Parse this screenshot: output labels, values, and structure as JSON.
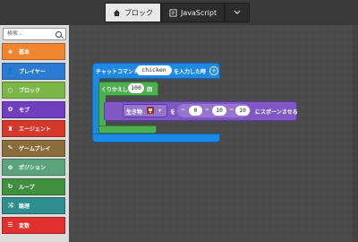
{
  "tabs": {
    "blocks_label": "ブロック",
    "javascript_label": "JavaScript"
  },
  "palette": {
    "search_placeholder": "検索...",
    "categories": [
      {
        "label": "基本",
        "color": "#f0852f",
        "icon": "star-icon"
      },
      {
        "label": "プレイヤー",
        "color": "#2b7bd1",
        "icon": "person-icon"
      },
      {
        "label": "ブロック",
        "color": "#7ab648",
        "icon": "cube-icon"
      },
      {
        "label": "モブ",
        "color": "#6f3fbf",
        "icon": "paw-icon"
      },
      {
        "label": "エージェント",
        "color": "#d6372b",
        "icon": "agent-icon"
      },
      {
        "label": "ゲームプレイ",
        "color": "#8a6d3b",
        "icon": "wrench-icon"
      },
      {
        "label": "ポジション",
        "color": "#5aa37c",
        "icon": "target-icon"
      },
      {
        "label": "ループ",
        "color": "#3f8f3f",
        "icon": "loop-icon"
      },
      {
        "label": "論理",
        "color": "#2f8f8f",
        "icon": "shuffle-icon"
      },
      {
        "label": "変数",
        "color": "#e0302f",
        "icon": "list-icon"
      }
    ]
  },
  "workspace": {
    "event_block": {
      "prefix": "チャットコマンド",
      "command_value": "chicken",
      "suffix": "を入力した時",
      "plus_symbol": "+"
    },
    "repeat_block": {
      "label": "くりかえし",
      "count": "100",
      "times_label": "回"
    },
    "spawn_block": {
      "mob_label": "生き物",
      "arrow": "▾",
      "at_label": "を",
      "coords_prefix": "~",
      "x": "0",
      "y": "10",
      "z": "10",
      "suffix": "にスポーンさせる"
    }
  }
}
